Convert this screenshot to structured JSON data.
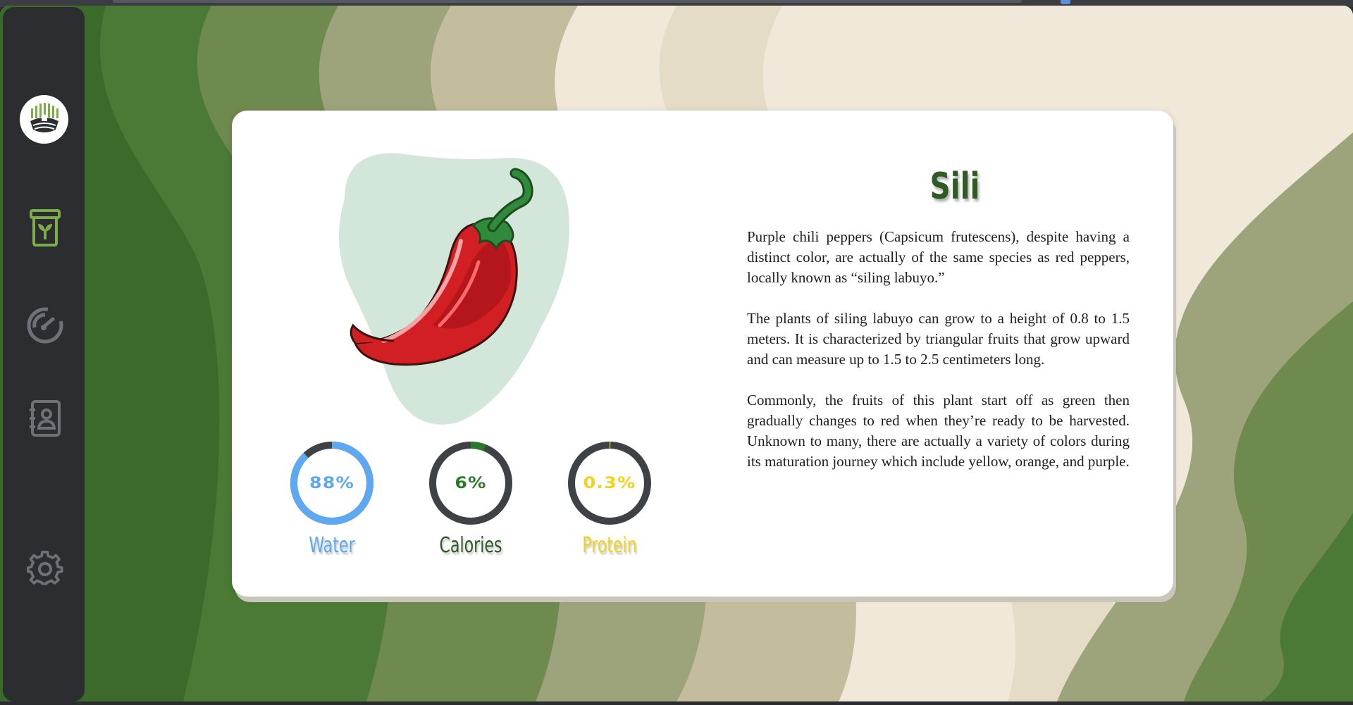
{
  "colors": {
    "sidebar_bg": "#2b2d31",
    "nav_active": "#7dad46",
    "nav_inactive": "#6e7178",
    "ring_track": "#3e4247",
    "water": "#5ea8f2",
    "calories": "#2a7a2a",
    "protein": "#f2d21c",
    "title": "#2f5a24",
    "blob": "#d2e7da"
  },
  "sidebar": {
    "logo_icon": "farm-logo-icon",
    "items": [
      {
        "name": "crops",
        "icon": "seed-bag-icon",
        "active": true
      },
      {
        "name": "dashboard",
        "icon": "gauge-icon",
        "active": false
      },
      {
        "name": "profile",
        "icon": "contact-book-icon",
        "active": false
      },
      {
        "name": "settings",
        "icon": "gear-icon",
        "active": false
      }
    ]
  },
  "crop": {
    "title": "Sili",
    "image_icon": "red-chili-pepper-illustration",
    "description": [
      "Purple chili peppers (Capsicum frutescens), despite having a distinct color, are actually of the same species as red peppers, locally known as “siling labuyo.”",
      "The plants of siling labuyo can grow to a height of 0.8 to 1.5 meters. It is characterized by triangular fruits that grow upward and can measure up to 1.5 to 2.5 centimeters long.",
      "Commonly, the fruits of this plant start off as green then gradually changes to red when they’re ready to be harvested. Unknown to many, there are actually a variety of colors during its maturation journey which include yellow, orange, and purple."
    ],
    "nutrition": [
      {
        "label": "Water",
        "value_text": "88%",
        "value": 88,
        "color": "#5ea8f2"
      },
      {
        "label": "Calories",
        "value_text": "6%",
        "value": 6,
        "color": "#2a7a2a"
      },
      {
        "label": "Protein",
        "value_text": "0.3%",
        "value": 0.3,
        "color": "#f2d21c"
      }
    ]
  }
}
